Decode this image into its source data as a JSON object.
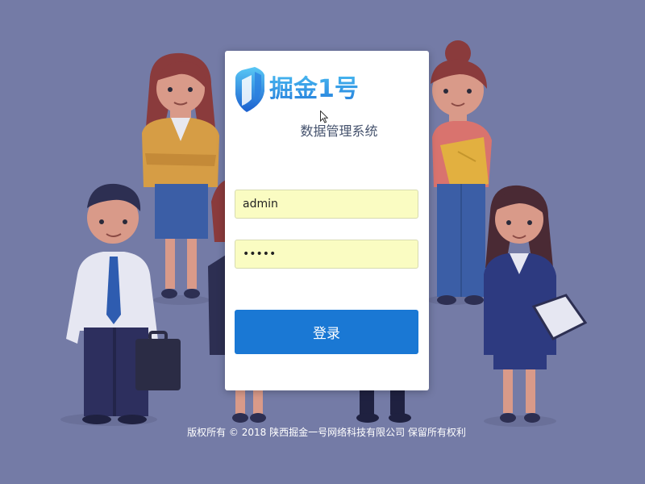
{
  "app": {
    "brand_name": "掘金1号",
    "system_title": "数据管理系统"
  },
  "form": {
    "username_value": "admin",
    "password_value": "•••••",
    "login_label": "登录"
  },
  "footer": {
    "copyright": "版权所有 © 2018 陕西掘金一号网络科技有限公司 保留所有权利"
  },
  "colors": {
    "background": "#747ba6",
    "primary_button": "#1a78d4",
    "input_autofill": "#fafcc2",
    "brand_blue": "#1d7fd8"
  },
  "icons": {
    "logo": "shield-logo-icon",
    "cursor": "mouse-pointer-icon"
  }
}
